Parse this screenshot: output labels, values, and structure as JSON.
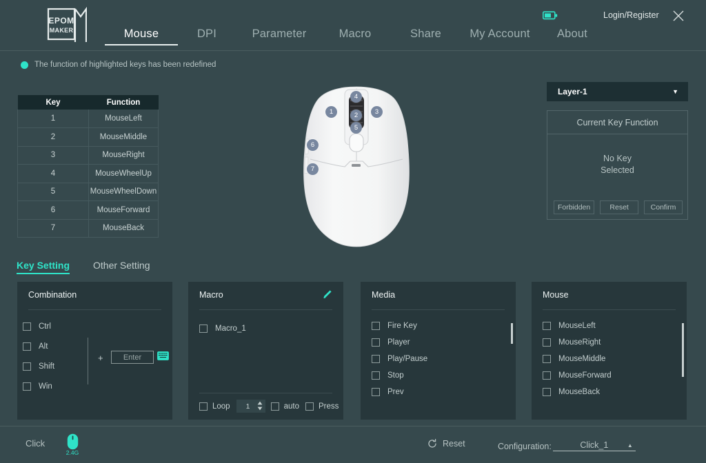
{
  "header": {
    "logo_text_top": "EPOM",
    "logo_text_bottom": "MAKER",
    "tabs": [
      {
        "label": "Mouse",
        "active": true
      },
      {
        "label": "DPI",
        "active": false
      },
      {
        "label": "Parameter",
        "active": false
      },
      {
        "label": "Macro",
        "active": false
      },
      {
        "label": "Share",
        "active": false
      },
      {
        "label": "My Account",
        "active": false
      },
      {
        "label": "About",
        "active": false
      }
    ],
    "battery_icon": "battery-icon",
    "battery_color": "#2fe3c8",
    "login_label": "Login/Register",
    "close_icon": "close-icon"
  },
  "notice": {
    "dot_color": "#2fe3c8",
    "text": "The function of highlighted keys has been redefined"
  },
  "key_table": {
    "columns": [
      "Key",
      "Function"
    ],
    "rows": [
      {
        "key": "1",
        "function": "MouseLeft"
      },
      {
        "key": "2",
        "function": "MouseMiddle"
      },
      {
        "key": "3",
        "function": "MouseRight"
      },
      {
        "key": "4",
        "function": "MouseWheelUp"
      },
      {
        "key": "5",
        "function": "MouseWheelDown"
      },
      {
        "key": "6",
        "function": "MouseForward"
      },
      {
        "key": "7",
        "function": "MouseBack"
      }
    ]
  },
  "mouse_diagram": {
    "badges": [
      "1",
      "2",
      "3",
      "4",
      "5",
      "6",
      "7"
    ],
    "badge_color": "#78879f"
  },
  "right_panel": {
    "layer_value": "Layer-1",
    "layer_caret": "chevron-down-icon",
    "current_key_title": "Current Key Function",
    "no_key_line1": "No Key",
    "no_key_line2": "Selected",
    "buttons": [
      "Forbidden",
      "Reset",
      "Confirm"
    ]
  },
  "setting_tabs": [
    {
      "label": "Key Setting",
      "active": true
    },
    {
      "label": "Other Setting",
      "active": false
    }
  ],
  "panels": {
    "combination": {
      "title": "Combination",
      "modifiers": [
        "Ctrl",
        "Alt",
        "Shift",
        "Win"
      ],
      "plus": "+",
      "key_value": "Enter",
      "keyboard_icon": "keyboard-icon"
    },
    "macro": {
      "title": "Macro",
      "edit_icon": "pencil-icon",
      "items": [
        "Macro_1"
      ],
      "loop_label": "Loop",
      "loop_count": "1",
      "auto_label": "auto",
      "press_label": "Press"
    },
    "media": {
      "title": "Media",
      "items": [
        "Fire Key",
        "Player",
        "Play/Pause",
        "Stop",
        "Prev"
      ]
    },
    "mouse": {
      "title": "Mouse",
      "items": [
        "MouseLeft",
        "MouseRight",
        "MouseMiddle",
        "MouseForward",
        "MouseBack"
      ]
    }
  },
  "footer": {
    "click_label": "Click",
    "device_icon": "mouse-device-icon",
    "device_label": "2.4G",
    "reset_icon": "refresh-icon",
    "reset_label": "Reset",
    "configuration_label": "Configuration:",
    "configuration_value": "Click_1",
    "configuration_caret": "chevron-up-icon"
  }
}
